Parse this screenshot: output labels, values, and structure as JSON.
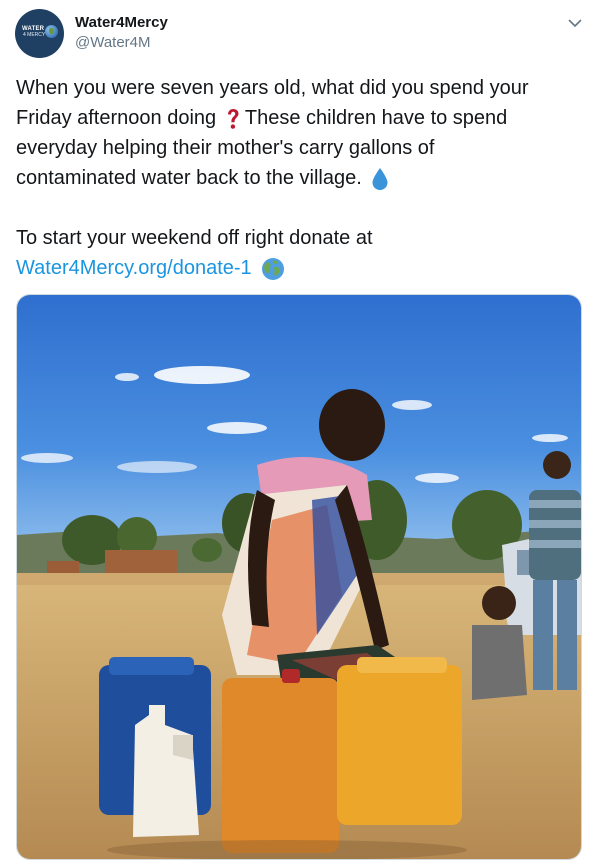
{
  "account": {
    "display_name": "Water4Mercy",
    "handle": "@Water4M",
    "avatar_text_line1": "WATER",
    "avatar_text_line2": "4 MERCY"
  },
  "tweet": {
    "line1": "When you were seven years old, what did you spend your",
    "line2": "Friday afternoon doing",
    "line2b": "These children have to spend",
    "line3": "everyday helping their mother's carry gallons of",
    "line4": "contaminated water back to the village.",
    "line5": "To start your weekend off right donate at",
    "link": "Water4Mercy.org/donate-1",
    "emojis": [
      "question-mark-emoji",
      "droplet-emoji",
      "globe-emoji"
    ]
  },
  "media": {
    "icon": "photo-of-children-with-water-jerrycans"
  },
  "colors": {
    "link": "#1b95e0",
    "text": "#14171a",
    "secondary": "#657786"
  }
}
